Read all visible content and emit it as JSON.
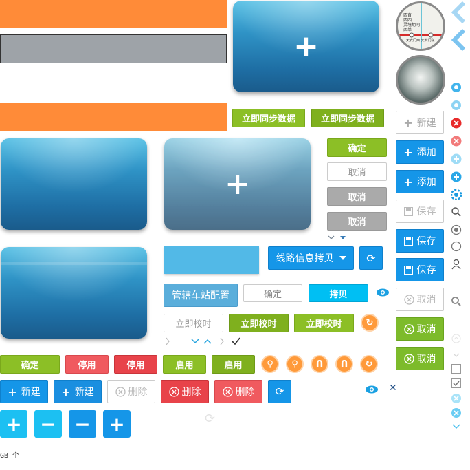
{
  "buttons": {
    "sync_1": "立即同步数据",
    "sync_2": "立即同步数据",
    "confirm_green": "确定",
    "cancel_outline": "取消",
    "cancel_gray_1": "取消",
    "cancel_gray_2": "取消",
    "route_copy": "线路信息拷贝",
    "station_config": "管辖车站配置",
    "confirm_outline": "确定",
    "copy_cyan": "拷贝",
    "calibrate_outline": "立即校时",
    "calibrate_green_1": "立即校时",
    "calibrate_green_2": "立即校时",
    "confirm_bottom": "确定",
    "disable_1": "停用",
    "disable_2": "停用",
    "enable_1": "启用",
    "enable_2": "启用",
    "new_1": "新建",
    "new_2": "新建",
    "delete_outline": "删除",
    "delete_red_1": "删除",
    "delete_red_2": "删除",
    "new_outline": "新建",
    "add_1": "添加",
    "add_2": "添加",
    "save_outline": "保存",
    "save_1": "保存",
    "save_2": "保存",
    "cancel_outline_2": "取消",
    "cancel_green_1": "取消",
    "cancel_green_2": "取消"
  },
  "map_thumb": {
    "labels": [
      "西直",
      "西四",
      "灵境胡同",
      "西单",
      "天安门西",
      "天安门东"
    ]
  },
  "footer_text": "GB 个",
  "icons": {
    "plus_glyph": "+",
    "minus_glyph": "−",
    "refresh_glyph": "⟳",
    "eye_glyph": "◉",
    "close_glyph": "✕",
    "check_glyph": "✓",
    "orange_glyph_a": "↻",
    "orange_glyph_b": "⚲",
    "orange_glyph_c": "ᑎ"
  },
  "colors": {
    "orange_bar": "#ff8b38",
    "green": "#8cbf26",
    "blue": "#1596e8",
    "red": "#e8434a",
    "cyan": "#00bff3"
  }
}
